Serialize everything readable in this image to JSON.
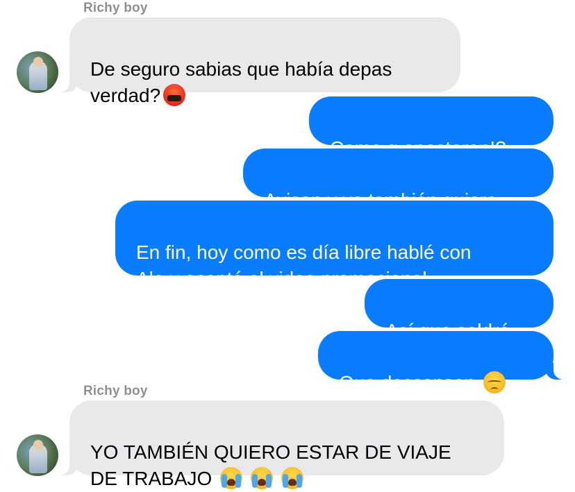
{
  "conversation": {
    "groups": [
      {
        "sender": "Richy boy",
        "message": {
          "text": "De seguro sabias que había depas\nverdad?",
          "emojis": [
            "angry-face-with-symbols-icon"
          ]
        }
      },
      {
        "sender": "Richy boy",
        "message": {
          "text": "YO TAMBIÉN QUIERO ESTAR DE VIAJE\nDE TRABAJO",
          "emojis": [
            "loudly-crying-face-icon",
            "loudly-crying-face-icon",
            "loudly-crying-face-icon"
          ]
        }
      }
    ],
    "outgoing": [
      {
        "text": "Como q apostaron!?"
      },
      {
        "text": "Avisen y yo también quiero"
      },
      {
        "text": "En fin, hoy como es día libre hablé con\nAle y acepté el video promocional"
      },
      {
        "text": "Así que saldré"
      },
      {
        "text": "Que descansen",
        "emojis": [
          "pensive-face-icon"
        ]
      }
    ]
  },
  "colors": {
    "incoming_bubble": "#e9e9eb",
    "outgoing_bubble": "#0a7cff",
    "sender_name": "#8e8e93"
  }
}
